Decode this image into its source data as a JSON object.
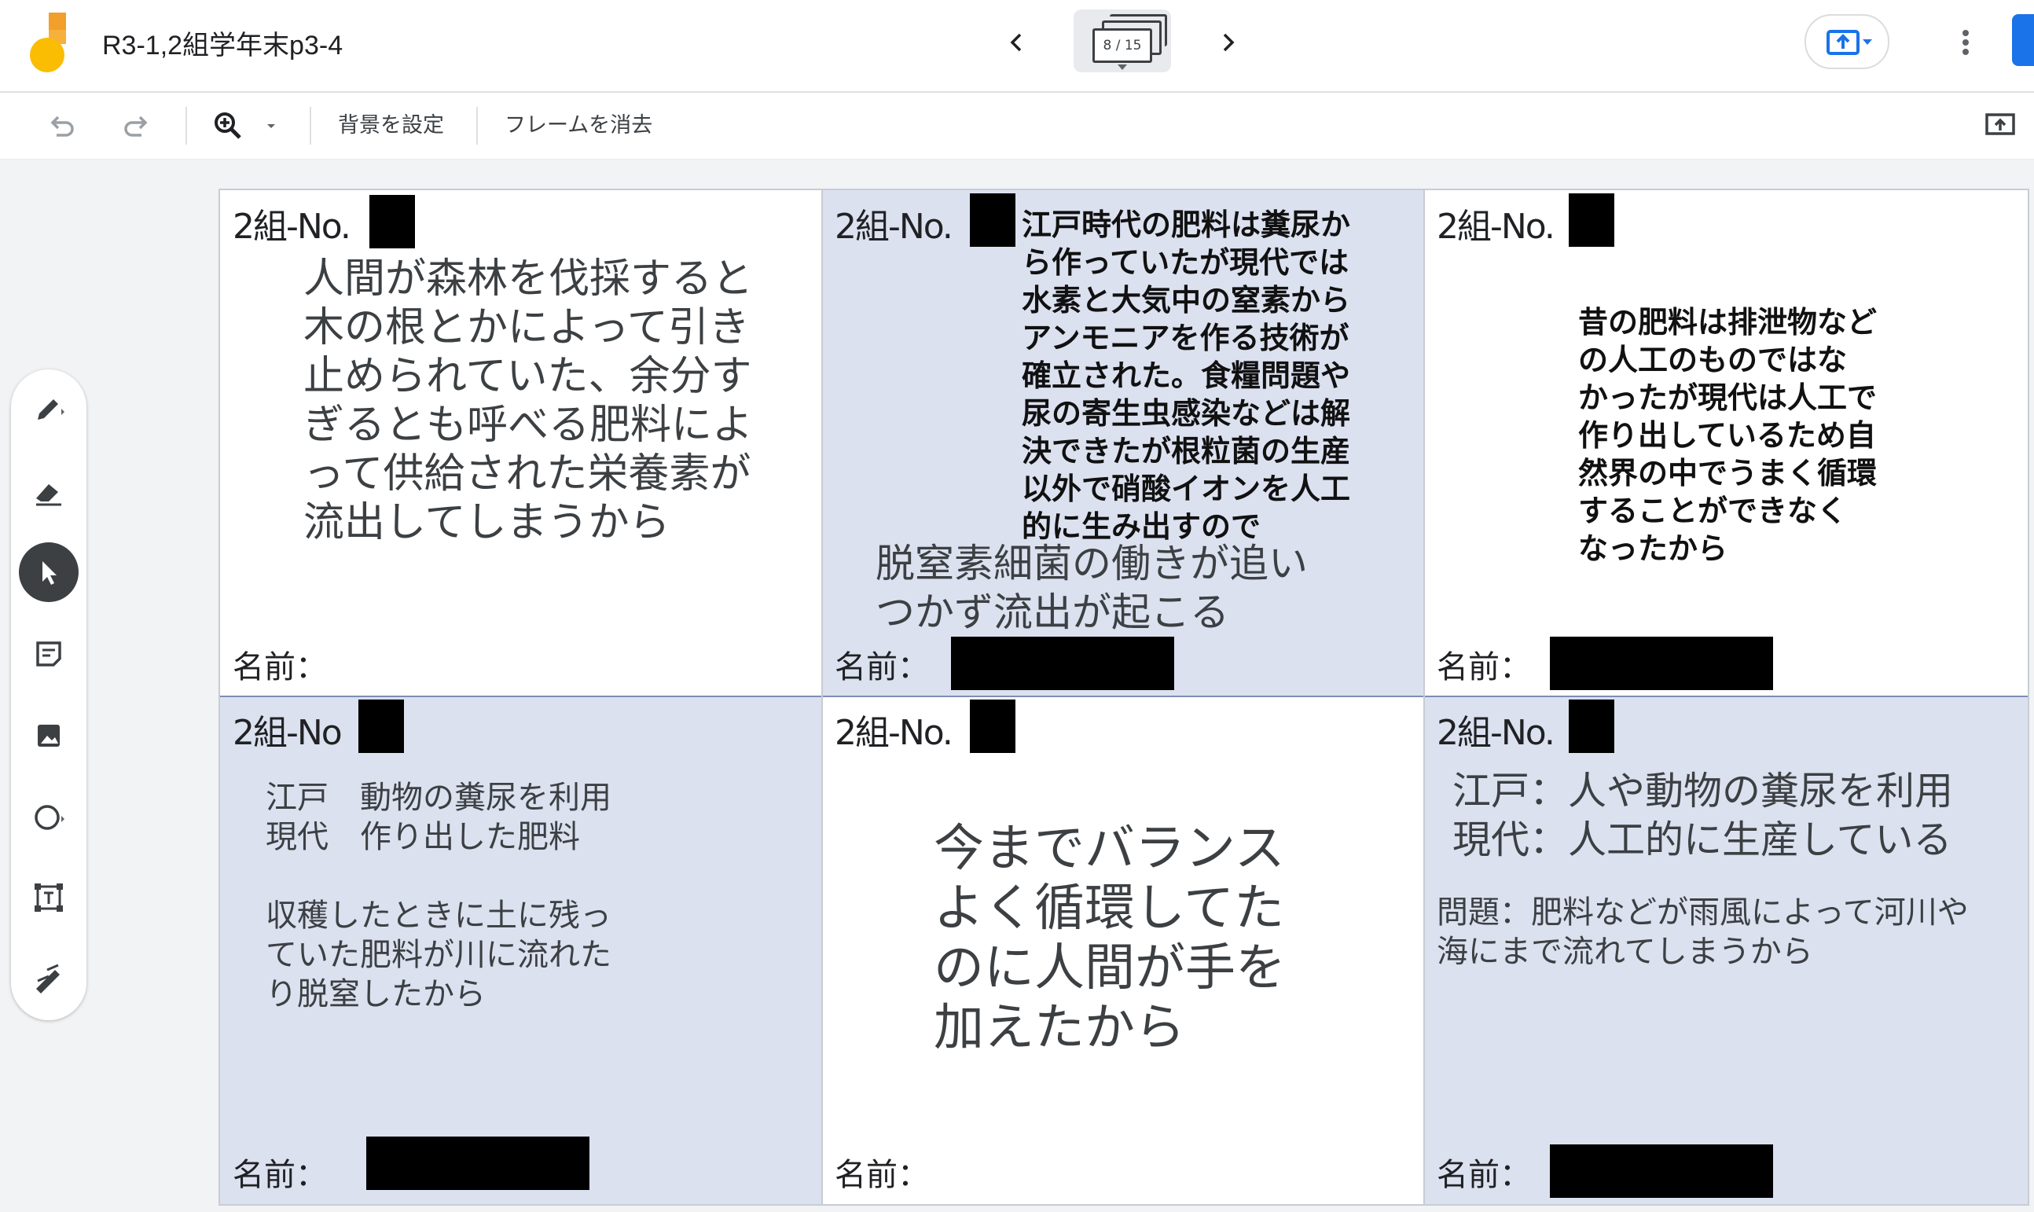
{
  "app": {
    "doc_title": "R3-1,2組学年末p3-4",
    "frame_indicator": "8 / 15"
  },
  "toolbar": {
    "set_background": "背景を設定",
    "clear_frame": "フレームを消去"
  },
  "colors": {
    "accent_blue": "#1a73e8",
    "cell_blue": "#dce1f0",
    "logo_yellow": "#fbbc04",
    "logo_orange": "#f29f2b"
  },
  "cells": [
    {
      "head": "2組-No.",
      "name_label": "名前：",
      "body": "人間が森林を伐採すると\n木の根とかによって引き\n止められていた、余分す\nぎるとも呼べる肥料によ\nって供給された栄養素が\n流出してしまうから"
    },
    {
      "head": "2組-No.",
      "name_label": "名前：",
      "body_bold": "江戸時代の肥料は糞尿か\nら作っていたが現代では\n水素と大気中の窒素から\nアンモニアを作る技術が\n確立された。食糧問題や\n尿の寄生虫感染などは解\n決できたが根粒菌の生産\n以外で硝酸イオンを人工\n的に生み出すので",
      "body": "脱窒素細菌の働きが追い\nつかず流出が起こる"
    },
    {
      "head": "2組-No.",
      "name_label": "名前：",
      "body_bold": "昔の肥料は排泄物など\nの人工のものではな\nかったが現代は人工で\n作り出しているため自\n然界の中でうまく循環\nすることができなく\nなったから"
    },
    {
      "head": "2組-No",
      "name_label": "名前：",
      "body": "江戸　動物の糞尿を利用\n現代　作り出した肥料\n\n収穫したときに土に残っ\nていた肥料が川に流れた\nり脱窒したから"
    },
    {
      "head": "2組-No.",
      "name_label": "名前：",
      "body": "今までバランス\nよく循環してた\nのに人間が手を\n加えたから"
    },
    {
      "head": "2組-No.",
      "name_label": "名前：",
      "body": "江戸：人や動物の糞尿を利用\n現代：人工的に生産している",
      "body2": "問題：肥料などが雨風によって河川や\n海にまで流れてしまうから"
    }
  ]
}
